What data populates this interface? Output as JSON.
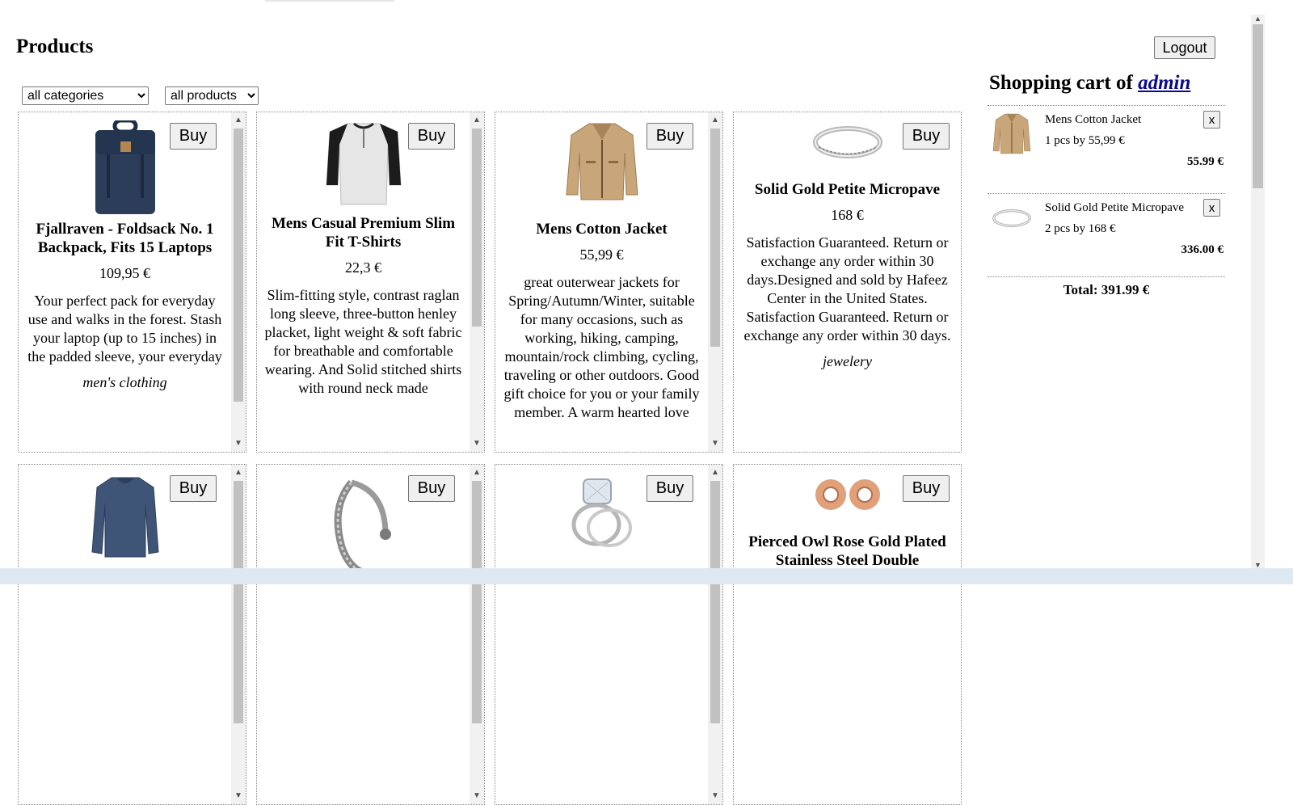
{
  "page": {
    "title": "Products"
  },
  "filters": {
    "category": {
      "selected": "all categories"
    },
    "products": {
      "selected": "all products"
    }
  },
  "buy_label": "Buy",
  "products": [
    {
      "name": "Fjallraven - Foldsack No. 1 Backpack, Fits 15 Laptops",
      "price": "109,95 €",
      "description": "Your perfect pack for everyday use and walks in the forest. Stash your laptop (up to 15 inches) in the padded sleeve, your everyday",
      "category": "men's clothing",
      "icon": "backpack-image"
    },
    {
      "name": "Mens Casual Premium Slim Fit T-Shirts",
      "price": "22,3 €",
      "description": "Slim-fitting style, contrast raglan long sleeve, three-button henley placket, light weight & soft fabric for breathable and comfortable wearing. And Solid stitched shirts with round neck made",
      "category": "",
      "icon": "tshirt-image"
    },
    {
      "name": "Mens Cotton Jacket",
      "price": "55,99 €",
      "description": "great outerwear jackets for Spring/Autumn/Winter, suitable for many occasions, such as working, hiking, camping, mountain/rock climbing, cycling, traveling or other outdoors. Good gift choice for you or your family member. A warm hearted love",
      "category": "",
      "icon": "jacket-image"
    },
    {
      "name": "Solid Gold Petite Micropave",
      "price": "168 €",
      "description": "Satisfaction Guaranteed. Return or exchange any order within 30 days.Designed and sold by Hafeez Center in the United States. Satisfaction Guaranteed. Return or exchange any order within 30 days.",
      "category": "jewelery",
      "icon": "ring-image"
    },
    {
      "name": "",
      "price": "",
      "description": "",
      "category": "",
      "icon": "longsleeve-image"
    },
    {
      "name": "",
      "price": "",
      "description": "",
      "category": "",
      "icon": "bracelet-image"
    },
    {
      "name": "",
      "price": "",
      "description": "",
      "category": "",
      "icon": "diamond-ring-image"
    },
    {
      "name": "Pierced Owl Rose Gold Plated Stainless Steel Double",
      "price": "",
      "description": "",
      "category": "",
      "icon": "earrings-image"
    }
  ],
  "account": {
    "logout_label": "Logout"
  },
  "cart": {
    "title_prefix": "Shopping cart of",
    "user": "admin",
    "remove_label": "x",
    "items": [
      {
        "name": "Mens Cotton Jacket",
        "qty_line": "1 pcs by 55,99 €",
        "subtotal": "55.99 €",
        "icon": "jacket-image"
      },
      {
        "name": "Solid Gold Petite Micropave",
        "qty_line": "2 pcs by 168 €",
        "subtotal": "336.00 €",
        "icon": "ring-image"
      }
    ],
    "total": "Total: 391.99 €"
  },
  "colors": {
    "link": "#0a0a8a",
    "scroll_thumb": "#c1c1c1",
    "border": "#888888"
  }
}
